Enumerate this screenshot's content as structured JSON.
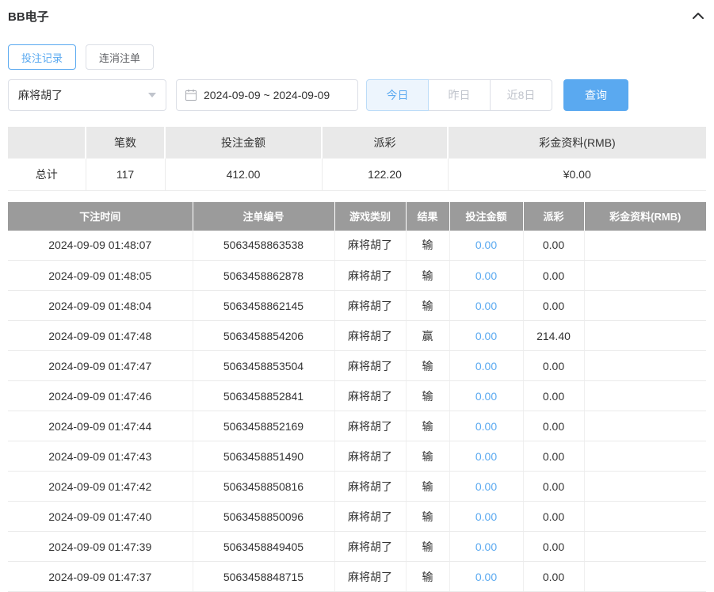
{
  "header": {
    "title": "BB电子"
  },
  "tabs": [
    {
      "label": "投注记录",
      "active": true
    },
    {
      "label": "连消注单",
      "active": false
    }
  ],
  "filters": {
    "game_select": {
      "value": "麻将胡了"
    },
    "date_range": {
      "value": "2024-09-09 ~ 2024-09-09"
    },
    "quick_buttons": [
      {
        "label": "今日",
        "active": true
      },
      {
        "label": "昨日",
        "active": false
      },
      {
        "label": "近8日",
        "active": false
      }
    ],
    "search_label": "查询"
  },
  "summary": {
    "headers": [
      "",
      "笔数",
      "投注金额",
      "派彩",
      "彩金资料(RMB)"
    ],
    "row": {
      "label": "总计",
      "count": "117",
      "bet_amount": "412.00",
      "payout": "122.20",
      "bonus": "¥0.00"
    }
  },
  "table": {
    "headers": [
      "下注时间",
      "注单编号",
      "游戏类别",
      "结果",
      "投注金额",
      "派彩",
      "彩金资料(RMB)"
    ],
    "rows": [
      {
        "time": "2024-09-09 01:48:07",
        "order_no": "5063458863538",
        "game": "麻将胡了",
        "result": "输",
        "bet": "0.00",
        "payout": "0.00",
        "bonus": ""
      },
      {
        "time": "2024-09-09 01:48:05",
        "order_no": "5063458862878",
        "game": "麻将胡了",
        "result": "输",
        "bet": "0.00",
        "payout": "0.00",
        "bonus": ""
      },
      {
        "time": "2024-09-09 01:48:04",
        "order_no": "5063458862145",
        "game": "麻将胡了",
        "result": "输",
        "bet": "0.00",
        "payout": "0.00",
        "bonus": ""
      },
      {
        "time": "2024-09-09 01:47:48",
        "order_no": "5063458854206",
        "game": "麻将胡了",
        "result": "赢",
        "bet": "0.00",
        "payout": "214.40",
        "bonus": ""
      },
      {
        "time": "2024-09-09 01:47:47",
        "order_no": "5063458853504",
        "game": "麻将胡了",
        "result": "输",
        "bet": "0.00",
        "payout": "0.00",
        "bonus": ""
      },
      {
        "time": "2024-09-09 01:47:46",
        "order_no": "5063458852841",
        "game": "麻将胡了",
        "result": "输",
        "bet": "0.00",
        "payout": "0.00",
        "bonus": ""
      },
      {
        "time": "2024-09-09 01:47:44",
        "order_no": "5063458852169",
        "game": "麻将胡了",
        "result": "输",
        "bet": "0.00",
        "payout": "0.00",
        "bonus": ""
      },
      {
        "time": "2024-09-09 01:47:43",
        "order_no": "5063458851490",
        "game": "麻将胡了",
        "result": "输",
        "bet": "0.00",
        "payout": "0.00",
        "bonus": ""
      },
      {
        "time": "2024-09-09 01:47:42",
        "order_no": "5063458850816",
        "game": "麻将胡了",
        "result": "输",
        "bet": "0.00",
        "payout": "0.00",
        "bonus": ""
      },
      {
        "time": "2024-09-09 01:47:40",
        "order_no": "5063458850096",
        "game": "麻将胡了",
        "result": "输",
        "bet": "0.00",
        "payout": "0.00",
        "bonus": ""
      },
      {
        "time": "2024-09-09 01:47:39",
        "order_no": "5063458849405",
        "game": "麻将胡了",
        "result": "输",
        "bet": "0.00",
        "payout": "0.00",
        "bonus": ""
      },
      {
        "time": "2024-09-09 01:47:37",
        "order_no": "5063458848715",
        "game": "麻将胡了",
        "result": "输",
        "bet": "0.00",
        "payout": "0.00",
        "bonus": ""
      }
    ]
  },
  "colors": {
    "accent": "#5aa9f0",
    "table_header_bg": "#9b9b9b",
    "summary_header_bg": "#e9e9e9",
    "inactive_text": "#c0c4cc"
  }
}
